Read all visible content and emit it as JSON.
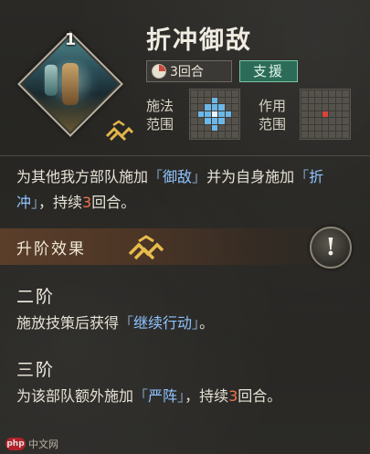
{
  "skill": {
    "level": "1",
    "name": "折冲御敌",
    "cooldown": "3回合",
    "type": "支援",
    "cast_range_label": "施法\n范围",
    "effect_range_label": "作用\n范围"
  },
  "description": {
    "part1": "为其他我方部队施加",
    "open1": "「",
    "kw1": "御敌",
    "close1": "」",
    "part2": "并为自身施加",
    "open2": "「",
    "kw2": "折冲",
    "close2": "」",
    "part3": "，持续",
    "duration": "3",
    "part4": "回合。"
  },
  "upgrade": {
    "title": "升阶效果",
    "info": "!"
  },
  "stages": [
    {
      "title": "二阶",
      "text_a": "施放技策后获得",
      "open": "「",
      "keyword": "继续行动",
      "close": "」",
      "text_b": "。"
    },
    {
      "title": "三阶",
      "text_a": "为该部队额外施加",
      "open": "「",
      "keyword": "严阵",
      "close": "」",
      "text_b": "，持续",
      "num": "3",
      "text_c": "回合。"
    }
  ],
  "watermark": {
    "logo": "php",
    "text": "中文网"
  },
  "colors": {
    "keyword": "#8fc3ff",
    "number": "#f2724f",
    "support_badge": "#2c6b57",
    "range_highlight": "#6cb7e8",
    "effect_target": "#d9443a"
  }
}
